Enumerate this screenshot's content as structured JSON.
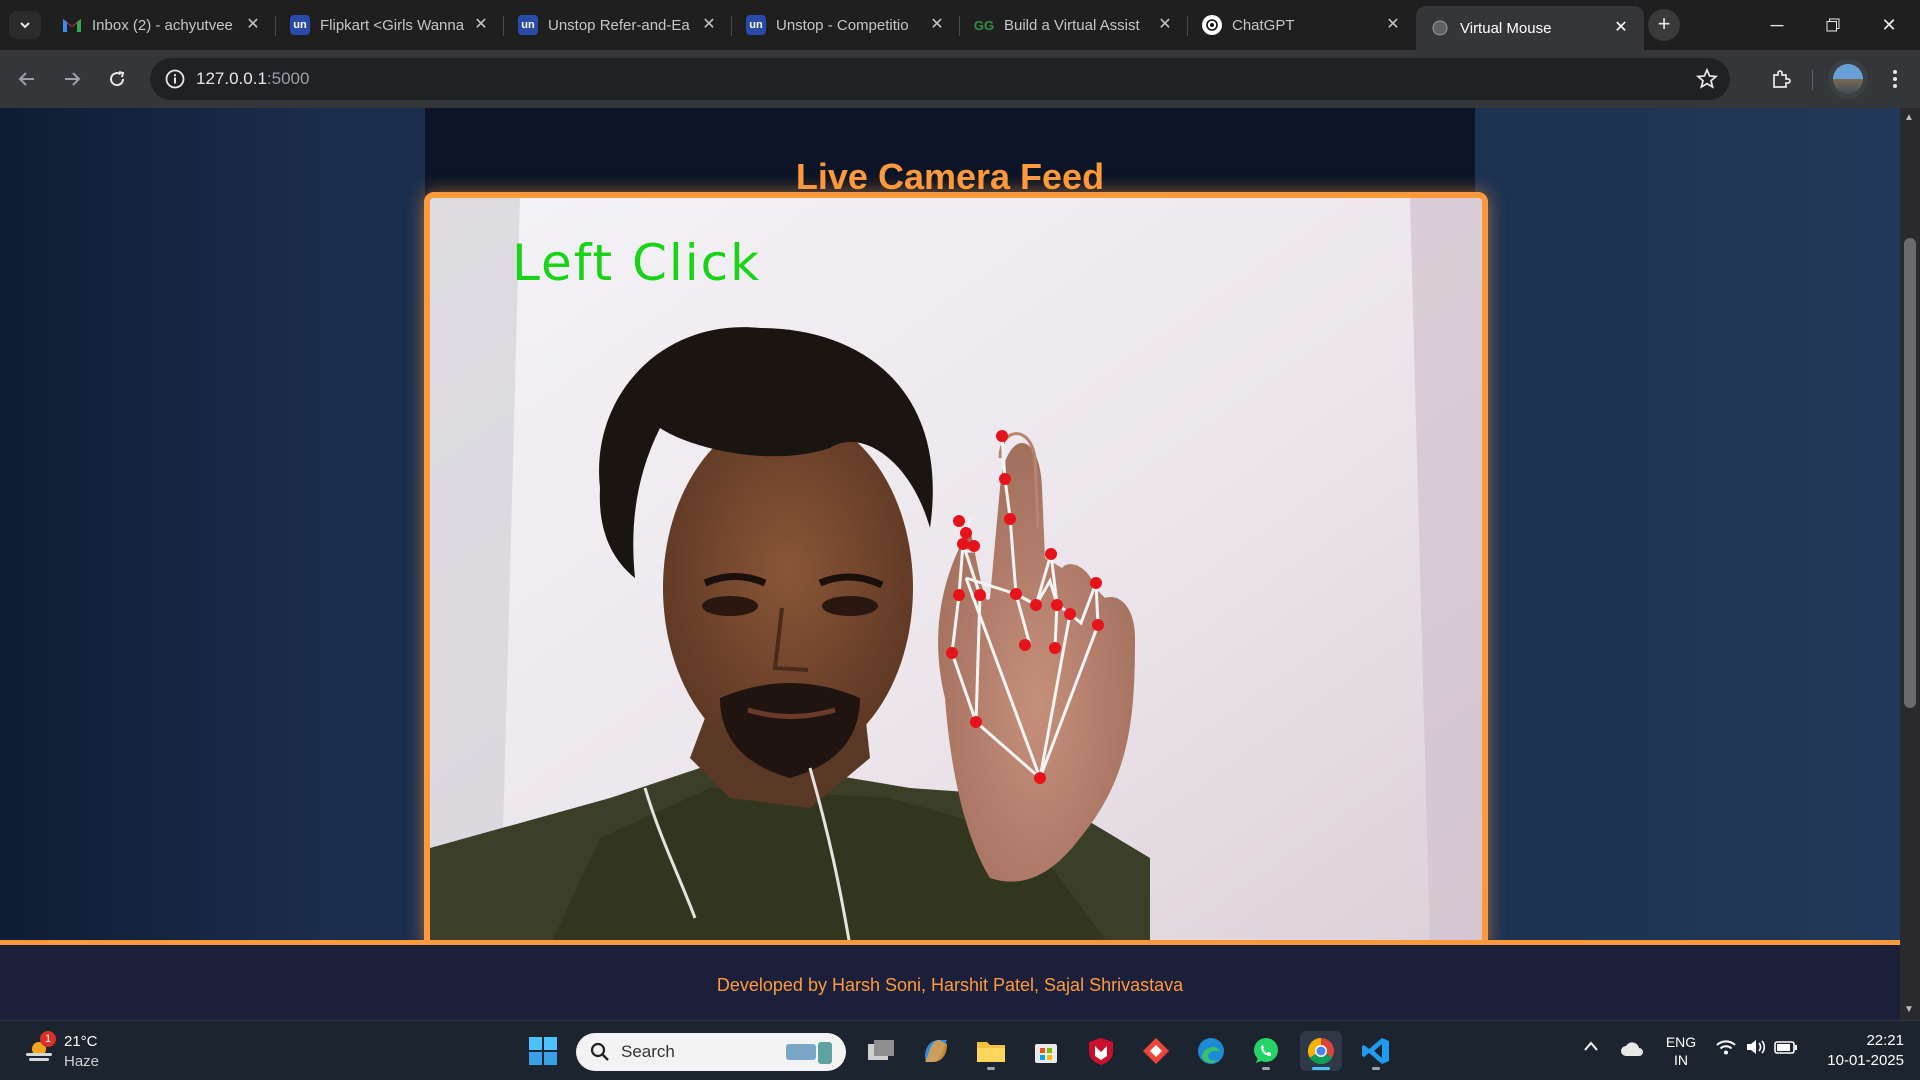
{
  "tabs": [
    {
      "title": "Inbox (2) - achyutvee",
      "icon": "gmail-icon"
    },
    {
      "title": "Flipkart <Girls Wanna",
      "icon": "unstop-icon"
    },
    {
      "title": "Unstop Refer-and-Ea",
      "icon": "unstop-icon"
    },
    {
      "title": "Unstop - Competitio",
      "icon": "unstop-icon"
    },
    {
      "title": "Build a Virtual Assist",
      "icon": "gfg-icon"
    },
    {
      "title": "ChatGPT",
      "icon": "chatgpt-icon"
    },
    {
      "title": "Virtual Mouse",
      "icon": "globe-icon"
    }
  ],
  "address_bar": {
    "host": "127.0.0.1",
    "port": ":5000"
  },
  "page": {
    "heading": "Live Camera Feed",
    "overlay_text": "Left Click",
    "footer": "Developed by Harsh Soni, Harshit Patel, Sajal Shrivastava"
  },
  "taskbar": {
    "weather": {
      "temp": "21°C",
      "condition": "Haze",
      "badge": "1"
    },
    "search_label": "Search",
    "lang": "ENG",
    "region": "IN",
    "time": "22:21",
    "date": "10-01-2025"
  },
  "colors": {
    "accent": "#ff9a3c",
    "overlay_text": "#19d319",
    "landmark": "#e8121b"
  }
}
